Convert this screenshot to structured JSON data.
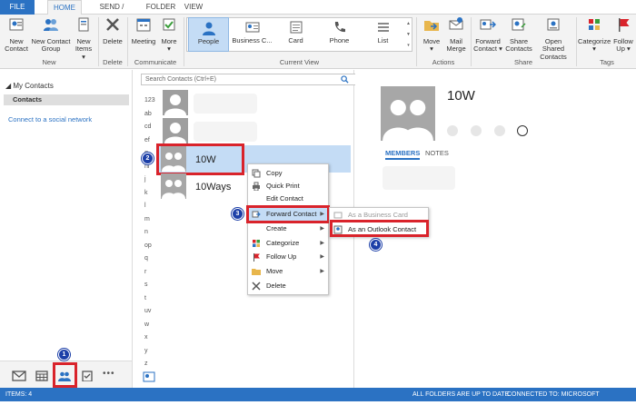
{
  "tabs": [
    "FILE",
    "HOME",
    "SEND / RECEIVE",
    "FOLDER",
    "VIEW"
  ],
  "ribbon": {
    "new": {
      "new_contact": "New\nContact",
      "new_group": "New Contact\nGroup",
      "new_items": "New\nItems ▾",
      "group": "New"
    },
    "delete": {
      "delete": "Delete",
      "group": "Delete"
    },
    "communicate": {
      "meeting": "Meeting",
      "more": "More\n▾",
      "group": "Communicate"
    },
    "current_view": {
      "items": [
        "People",
        "Business C...",
        "Card",
        "Phone",
        "List"
      ],
      "selected": "People",
      "group": "Current View"
    },
    "actions": {
      "move": "Move\n▾",
      "mail_merge": "Mail\nMerge",
      "group": "Actions"
    },
    "share": {
      "forward": "Forward\nContact ▾",
      "share": "Share\nContacts",
      "open_shared": "Open Shared\nContacts",
      "group": "Share"
    },
    "tags": {
      "categorize": "Categorize\n▾",
      "follow_up": "Follow\nUp ▾",
      "group": "Tags"
    }
  },
  "nav": {
    "my_contacts": "◢ My Contacts",
    "contacts": "Contacts",
    "social": "Connect to a social network"
  },
  "search": {
    "placeholder": "Search Contacts (Ctrl+E)"
  },
  "letters": [
    "123",
    "ab",
    "cd",
    "ef",
    "g",
    "hi",
    "j",
    "k",
    "l",
    "m",
    "n",
    "op",
    "q",
    "r",
    "s",
    "t",
    "uv",
    "w",
    "x",
    "y",
    "z"
  ],
  "contacts": [
    {
      "name": "10W"
    },
    {
      "name": "10Ways"
    }
  ],
  "pane": {
    "name": "10W",
    "members": "MEMBERS",
    "notes": "NOTES"
  },
  "context_menu": {
    "items": [
      "Copy",
      "Quick Print",
      "Edit Contact",
      "Forward Contact",
      "Create",
      "Categorize",
      "Follow Up",
      "Move",
      "Delete"
    ]
  },
  "submenu": {
    "items": [
      "As a Business Card",
      "As an Outlook Contact"
    ]
  },
  "steps": [
    "1",
    "2",
    "3",
    "4"
  ],
  "status": {
    "items": "ITEMS: 4",
    "folders": "ALL FOLDERS ARE UP TO DATE.",
    "exchange": "CONNECTED TO: MICROSOFT EXCHANGE"
  },
  "colors": {
    "accent": "#2b72c3",
    "highlight": "#d9232b",
    "step": "#1c3fa8",
    "selection": "#c4dcf5"
  }
}
